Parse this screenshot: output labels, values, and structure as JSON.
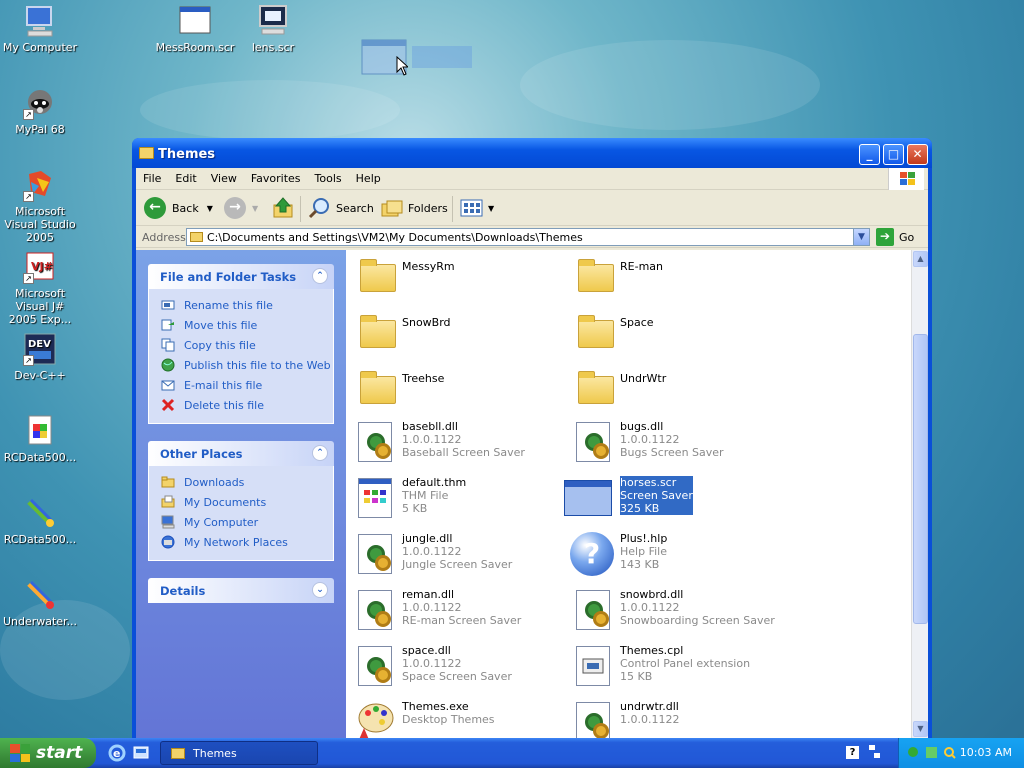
{
  "desktop": {
    "icons": [
      {
        "label": "My Computer"
      },
      {
        "label": "MessRoom.scr"
      },
      {
        "label": "lens.scr"
      },
      {
        "label": "MyPal 68"
      },
      {
        "label": "Microsoft Visual Studio 2005"
      },
      {
        "label": "Microsoft Visual J# 2005 Exp..."
      },
      {
        "label": "Dev-C++"
      },
      {
        "label": "RCData500..."
      },
      {
        "label": "RCData500..."
      },
      {
        "label": "Underwater..."
      }
    ],
    "shortcut_glyph": "↗"
  },
  "window": {
    "title": "Themes",
    "buttons": {
      "minimize": "_",
      "maximize": "□",
      "close": "✕"
    },
    "menu": [
      "File",
      "Edit",
      "View",
      "Favorites",
      "Tools",
      "Help"
    ],
    "toolbar": {
      "back": "Back",
      "search": "Search",
      "folders": "Folders"
    },
    "address": {
      "label": "Address",
      "path": "C:\\Documents and Settings\\VM2\\My Documents\\Downloads\\Themes",
      "go": "Go"
    }
  },
  "tasks": {
    "file_folder": {
      "title": "File and Folder Tasks",
      "items": [
        "Rename this file",
        "Move this file",
        "Copy this file",
        "Publish this file to the Web",
        "E-mail this file",
        "Delete this file"
      ]
    },
    "other_places": {
      "title": "Other Places",
      "items": [
        "Downloads",
        "My Documents",
        "My Computer",
        "My Network Places"
      ]
    },
    "details": {
      "title": "Details"
    }
  },
  "files": [
    {
      "name": "MessyRm",
      "type": "folder"
    },
    {
      "name": "RE-man",
      "type": "folder"
    },
    {
      "name": "SnowBrd",
      "type": "folder"
    },
    {
      "name": "Space",
      "type": "folder"
    },
    {
      "name": "Treehse",
      "type": "folder"
    },
    {
      "name": "UndrWtr",
      "type": "folder"
    },
    {
      "name": "basebll.dll",
      "l2": "1.0.0.1122",
      "l3": "Baseball Screen Saver",
      "type": "dll"
    },
    {
      "name": "bugs.dll",
      "l2": "1.0.0.1122",
      "l3": "Bugs Screen Saver",
      "type": "dll"
    },
    {
      "name": "default.thm",
      "l2": "THM File",
      "l3": "5 KB",
      "type": "thm"
    },
    {
      "name": "horses.scr",
      "l2": "Screen Saver",
      "l3": "325 KB",
      "type": "scr",
      "selected": true
    },
    {
      "name": "jungle.dll",
      "l2": "1.0.0.1122",
      "l3": "Jungle Screen Saver",
      "type": "dll"
    },
    {
      "name": "Plus!.hlp",
      "l2": "Help File",
      "l3": "143 KB",
      "type": "hlp"
    },
    {
      "name": "reman.dll",
      "l2": "1.0.0.1122",
      "l3": "RE-man Screen Saver",
      "type": "dll"
    },
    {
      "name": "snowbrd.dll",
      "l2": "1.0.0.1122",
      "l3": "Snowboarding Screen Saver",
      "type": "dll"
    },
    {
      "name": "space.dll",
      "l2": "1.0.0.1122",
      "l3": "Space Screen Saver",
      "type": "dll"
    },
    {
      "name": "Themes.cpl",
      "l2": "Control Panel extension",
      "l3": "15 KB",
      "type": "cpl"
    },
    {
      "name": "Themes.exe",
      "l2": "Desktop Themes",
      "l3": "",
      "type": "exe"
    },
    {
      "name": "undrwtr.dll",
      "l2": "1.0.0.1122",
      "l3": "",
      "type": "dll"
    }
  ],
  "taskbar": {
    "start": "start",
    "task": "Themes",
    "clock": "10:03 AM"
  },
  "icons": {
    "chevron_up": "⌃",
    "chevron_down": "⌄",
    "dropdown": "▼",
    "help_glyph": "?",
    "go_arrow": "➔",
    "back_arrow": "←",
    "forward_arrow": "→",
    "scroll_up": "▲",
    "scroll_down": "▼"
  },
  "colors": {
    "task_link": "#215dc6",
    "selection": "#316ac5",
    "titlebar": "#0856e3"
  }
}
